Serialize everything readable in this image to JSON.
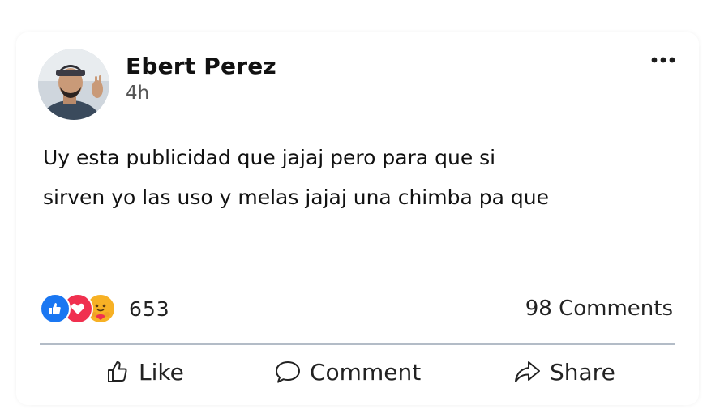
{
  "post": {
    "author_name": "Ebert Perez",
    "timestamp": "4h",
    "more_label": "•••",
    "text": "Uy esta publicidad que jajaj pero para que si\nsirven yo las uso y melas jajaj una chimba pa que"
  },
  "reactions": {
    "icons": [
      "like-reaction-icon",
      "love-reaction-icon",
      "care-reaction-icon"
    ],
    "count": "653"
  },
  "comments": {
    "label": "98 Comments"
  },
  "actions": {
    "like_label": "Like",
    "comment_label": "Comment",
    "share_label": "Share"
  },
  "colors": {
    "like_blue": "#1a77f2",
    "love_red": "#f0304f",
    "care_yellow": "#f7b125",
    "divider": "#b3bcc7"
  }
}
